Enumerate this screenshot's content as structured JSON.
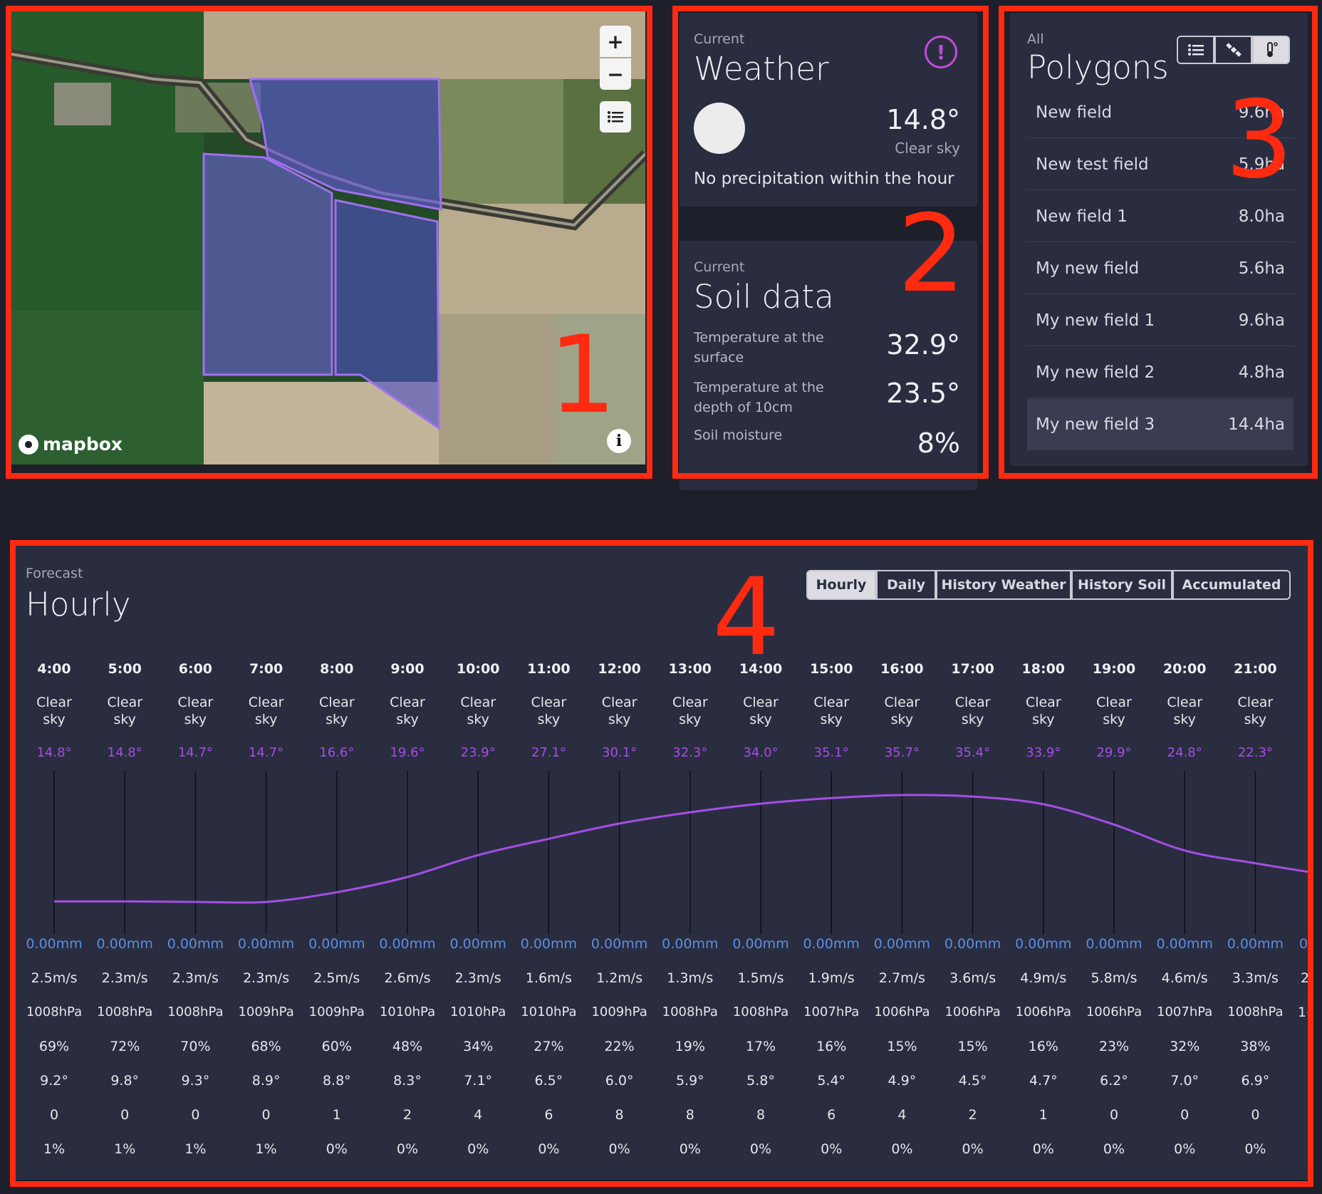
{
  "map": {
    "brand": "mapbox",
    "zoom_in": "+",
    "zoom_out": "−",
    "list_icon": "list-icon",
    "info_icon": "info-icon"
  },
  "weather": {
    "kicker": "Current",
    "title": "Weather",
    "temperature": "14.8°",
    "condition": "Clear sky",
    "precip_note": "No precipitation within the hour",
    "alert_icon": "alert-icon"
  },
  "soil": {
    "kicker": "Current",
    "title": "Soil data",
    "rows": [
      {
        "label_l1": "Temperature at the",
        "label_l2": "surface",
        "value": "32.9°"
      },
      {
        "label_l1": "Temperature at the",
        "label_l2": "depth of 10cm",
        "value": "23.5°"
      },
      {
        "label_l1": "Soil moisture",
        "label_l2": "",
        "value": "8%"
      }
    ]
  },
  "polygons": {
    "kicker": "All",
    "title": "Polygons",
    "view_buttons": [
      "list-icon",
      "satellite-icon",
      "thermometer-icon"
    ],
    "items": [
      {
        "name": "New field",
        "area": "9.6ha"
      },
      {
        "name": "New test field",
        "area": "5.9ha"
      },
      {
        "name": "New field 1",
        "area": "8.0ha"
      },
      {
        "name": "My new field",
        "area": "5.6ha"
      },
      {
        "name": "My new field 1",
        "area": "9.6ha"
      },
      {
        "name": "My new field 2",
        "area": "4.8ha"
      },
      {
        "name": "My new field 3",
        "area": "14.4ha"
      }
    ]
  },
  "forecast": {
    "kicker": "Forecast",
    "title": "Hourly",
    "tabs": [
      "Hourly",
      "Daily",
      "History Weather",
      "History Soil",
      "Accumulated"
    ],
    "active_tab": "Hourly",
    "hours": [
      "4:00",
      "5:00",
      "6:00",
      "7:00",
      "8:00",
      "9:00",
      "10:00",
      "11:00",
      "12:00",
      "13:00",
      "14:00",
      "15:00",
      "16:00",
      "17:00",
      "18:00",
      "19:00",
      "20:00",
      "21:00"
    ],
    "cond_l1": "Clear",
    "cond_l2": "sky",
    "temps": [
      "14.8°",
      "14.8°",
      "14.7°",
      "14.7°",
      "16.6°",
      "19.6°",
      "23.9°",
      "27.1°",
      "30.1°",
      "32.3°",
      "34.0°",
      "35.1°",
      "35.7°",
      "35.4°",
      "33.9°",
      "29.9°",
      "24.8°",
      "22.3°"
    ],
    "precip": [
      "0.00mm",
      "0.00mm",
      "0.00mm",
      "0.00mm",
      "0.00mm",
      "0.00mm",
      "0.00mm",
      "0.00mm",
      "0.00mm",
      "0.00mm",
      "0.00mm",
      "0.00mm",
      "0.00mm",
      "0.00mm",
      "0.00mm",
      "0.00mm",
      "0.00mm",
      "0.00mm"
    ],
    "wind": [
      "2.5m/s",
      "2.3m/s",
      "2.3m/s",
      "2.3m/s",
      "2.5m/s",
      "2.6m/s",
      "2.3m/s",
      "1.6m/s",
      "1.2m/s",
      "1.3m/s",
      "1.5m/s",
      "1.9m/s",
      "2.7m/s",
      "3.6m/s",
      "4.9m/s",
      "5.8m/s",
      "4.6m/s",
      "3.3m/s"
    ],
    "pressure": [
      "1008hPa",
      "1008hPa",
      "1008hPa",
      "1009hPa",
      "1009hPa",
      "1010hPa",
      "1010hPa",
      "1010hPa",
      "1009hPa",
      "1008hPa",
      "1008hPa",
      "1007hPa",
      "1006hPa",
      "1006hPa",
      "1006hPa",
      "1006hPa",
      "1007hPa",
      "1008hPa"
    ],
    "humidity": [
      "69%",
      "72%",
      "70%",
      "68%",
      "60%",
      "48%",
      "34%",
      "27%",
      "22%",
      "19%",
      "17%",
      "16%",
      "15%",
      "15%",
      "16%",
      "23%",
      "32%",
      "38%"
    ],
    "dew_point": [
      "9.2°",
      "9.8°",
      "9.3°",
      "8.9°",
      "8.8°",
      "8.3°",
      "7.1°",
      "6.5°",
      "6.0°",
      "5.9°",
      "5.8°",
      "5.4°",
      "4.9°",
      "4.5°",
      "4.7°",
      "6.2°",
      "7.0°",
      "6.9°"
    ],
    "uvi": [
      "0",
      "0",
      "0",
      "0",
      "1",
      "2",
      "4",
      "6",
      "8",
      "8",
      "8",
      "6",
      "4",
      "2",
      "1",
      "0",
      "0",
      "0"
    ],
    "clouds": [
      "1%",
      "1%",
      "1%",
      "1%",
      "0%",
      "0%",
      "0%",
      "0%",
      "0%",
      "0%",
      "0%",
      "0%",
      "0%",
      "0%",
      "0%",
      "0%",
      "0%",
      "0%"
    ],
    "partial_next": {
      "precip": "0",
      "wind": "2",
      "pressure": "1("
    },
    "line_color": "#a44ee6",
    "temp_color": "#a44ee6",
    "precip_color": "#5a8de6"
  },
  "annotations": [
    "1",
    "2",
    "3",
    "4"
  ]
}
